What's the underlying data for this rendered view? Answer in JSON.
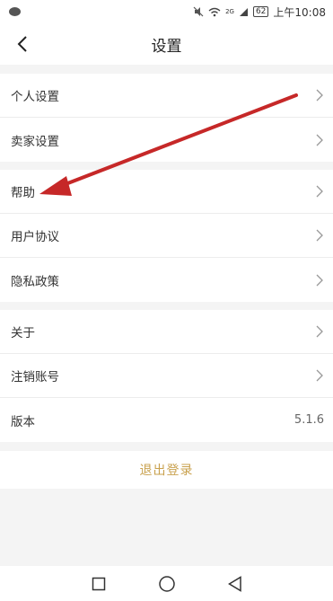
{
  "status_bar": {
    "battery": "62",
    "signal_label": "2G",
    "time": "上午10:08",
    "icons": [
      "wechat-icon",
      "mute-icon",
      "wifi-icon",
      "signal-icon",
      "battery-icon"
    ]
  },
  "header": {
    "title": "设置",
    "back_icon": "back-arrow-icon"
  },
  "groups": [
    {
      "items": [
        {
          "label": "个人设置"
        },
        {
          "label": "卖家设置"
        }
      ]
    },
    {
      "items": [
        {
          "label": "帮助"
        },
        {
          "label": "用户协议"
        },
        {
          "label": "隐私政策"
        }
      ]
    },
    {
      "items": [
        {
          "label": "关于"
        },
        {
          "label": "注销账号"
        },
        {
          "label": "版本",
          "value": "5.1.6"
        }
      ]
    }
  ],
  "logout_label": "退出登录",
  "bottom_nav": {
    "icons": [
      "square-recent-icon",
      "circle-home-icon",
      "triangle-back-icon"
    ]
  },
  "colors": {
    "accent": "#c9a14e",
    "annotation_arrow": "#c62828",
    "background": "#f4f4f4"
  }
}
